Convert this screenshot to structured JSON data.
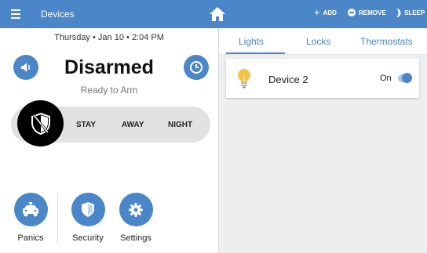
{
  "header": {
    "title": "Devices",
    "add_label": "ADD",
    "remove_label": "REMOVE",
    "sleep_label": "SLEEP",
    "bar_color": "#4a86c8"
  },
  "security": {
    "date": "Thursday",
    "day": "Jan 10",
    "time": "2:04 PM",
    "status": "Disarmed",
    "substatus": "Ready to Arm",
    "modes": [
      "STAY",
      "AWAY",
      "NIGHT"
    ]
  },
  "bottom_nav": {
    "items": [
      {
        "label": "Panics",
        "icon": "police-car-icon"
      },
      {
        "label": "Security",
        "icon": "shield-icon"
      },
      {
        "label": "Settings",
        "icon": "gear-icon"
      }
    ]
  },
  "tabs": [
    "Lights",
    "Locks",
    "Thermostats"
  ],
  "active_tab": "Lights",
  "devices": [
    {
      "name": "Device 2",
      "state": "On",
      "icon": "lightbulb-icon",
      "on": true
    }
  ]
}
